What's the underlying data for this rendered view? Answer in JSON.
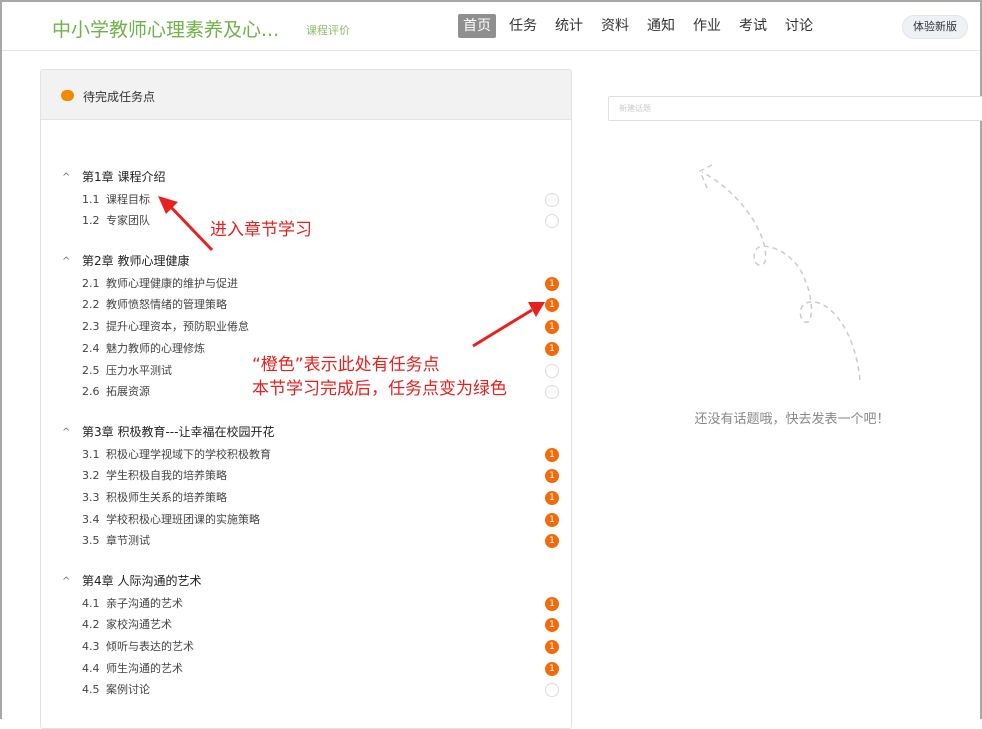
{
  "header": {
    "title": "中小学教师心理素养及心...",
    "rating_link": "课程评价",
    "nav": [
      "首页",
      "任务",
      "统计",
      "资料",
      "通知",
      "作业",
      "考试",
      "讨论"
    ],
    "active_nav": 0,
    "new_version": "体验新版"
  },
  "panel": {
    "title": "待完成任务点"
  },
  "chapters": [
    {
      "title": "第1章  课程介绍",
      "items": [
        {
          "num": "1.1",
          "title": "课程目标",
          "tasks": 0
        },
        {
          "num": "1.2",
          "title": "专家团队",
          "tasks": 0
        }
      ]
    },
    {
      "title": "第2章  教师心理健康",
      "items": [
        {
          "num": "2.1",
          "title": "教师心理健康的维护与促进",
          "tasks": 1
        },
        {
          "num": "2.2",
          "title": "教师愤怒情绪的管理策略",
          "tasks": 1
        },
        {
          "num": "2.3",
          "title": "提升心理资本，预防职业倦怠",
          "tasks": 1
        },
        {
          "num": "2.4",
          "title": "魅力教师的心理修炼",
          "tasks": 1
        },
        {
          "num": "2.5",
          "title": "压力水平测试",
          "tasks": 0
        },
        {
          "num": "2.6",
          "title": "拓展资源",
          "tasks": 0
        }
      ]
    },
    {
      "title": "第3章  积极教育---让幸福在校园开花",
      "items": [
        {
          "num": "3.1",
          "title": "积极心理学视域下的学校积极教育",
          "tasks": 1
        },
        {
          "num": "3.2",
          "title": "学生积极自我的培养策略",
          "tasks": 1
        },
        {
          "num": "3.3",
          "title": "积极师生关系的培养策略",
          "tasks": 1
        },
        {
          "num": "3.4",
          "title": "学校积极心理班团课的实施策略",
          "tasks": 1
        },
        {
          "num": "3.5",
          "title": "章节测试",
          "tasks": 1
        }
      ]
    },
    {
      "title": "第4章  人际沟通的艺术",
      "items": [
        {
          "num": "4.1",
          "title": "亲子沟通的艺术",
          "tasks": 1
        },
        {
          "num": "4.2",
          "title": "家校沟通艺术",
          "tasks": 1
        },
        {
          "num": "4.3",
          "title": "倾听与表达的艺术",
          "tasks": 1
        },
        {
          "num": "4.4",
          "title": "师生沟通的艺术",
          "tasks": 1
        },
        {
          "num": "4.5",
          "title": "案例讨论",
          "tasks": 0
        }
      ]
    }
  ],
  "annotations": {
    "enter": "进入章节学习",
    "orange_line1": "“橙色”表示此处有任务点",
    "orange_line2": "本节学习完成后，任务点变为绿色"
  },
  "discussion": {
    "placeholder": "新建话题",
    "empty": "还没有话题哦，快去发表一个吧！"
  },
  "colors": {
    "brand": "#6fb248",
    "task": "#f26b0a",
    "annotation": "#e8201e"
  }
}
